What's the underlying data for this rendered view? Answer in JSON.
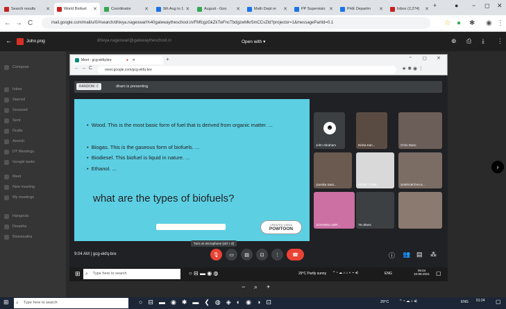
{
  "outer_tabs": [
    {
      "label": "Search results",
      "color": "#c5221f"
    },
    {
      "label": "World Biofuel",
      "color": "#c5221f"
    },
    {
      "label": "Coordinator",
      "color": "#34a853"
    },
    {
      "label": "9th Aug to 1",
      "color": "#1a73e8"
    },
    {
      "label": "August - Goo",
      "color": "#34a853"
    },
    {
      "label": "Math Dept re",
      "color": "#1a73e8"
    },
    {
      "label": "PP Supervisio",
      "color": "#1a73e8"
    },
    {
      "label": "PHE Departm",
      "color": "#1a73e8"
    },
    {
      "label": "Inbox (2,274)",
      "color": "#c5221f"
    }
  ],
  "outer_url": "mail.google.com/mail/u/0/#search/dhivya.nageswari%40gatewaytheschool.in/FMfcgzGkZkTwFncTbdgzwMkr5mCCvZld?projector=1&messagePartId=0.1",
  "preview": {
    "filename": "John.png",
    "search_text": "dhivya.nageswari@gatewaytheschool.in",
    "open_with": "Open with"
  },
  "gmail_sidebar": [
    "Compose",
    "Inbox",
    "Starred",
    "Snoozed",
    "Sent",
    "Drafts",
    "Amrish",
    "DT Meetings",
    "Google tasks",
    "Meet",
    "New meeting",
    "My meetings",
    "Hangouts",
    "Deepika",
    "Biswanatha"
  ],
  "meet": {
    "tab_title": "Meet - gcg-ekfq-bre",
    "url": "meet.google.com/gcg-ekfq-bre",
    "presenting_label": "RANDOM",
    "presenting_text": "dham is presenting",
    "time_code": "9:04 AM  |  gcg-ekfq-bre",
    "tooltip": "Turn on microphone (ctrl + d)"
  },
  "slide": {
    "bullets": [
      "Wood. This is the most basic form of fuel that is derived from organic matter. ...",
      "Biogas. This is the gaseous form of biofuels. ...",
      "Biodiesel. This biofuel is liquid in nature. ...",
      "Ethanol. ..."
    ],
    "question": "what are the types of biofuels?",
    "logo_top": "CREATED USING",
    "logo": "POWTOON"
  },
  "participants": [
    {
      "name": "John Abraham"
    },
    {
      "name": "Nisha Kan..."
    },
    {
      "name": "Chris Dario"
    },
    {
      "name": "Janvika Sant..."
    },
    {
      "name": "Rithvik Thilak..."
    },
    {
      "name": "SAMYUKTHA K..."
    },
    {
      "name": "JOHANNA ABR..."
    },
    {
      "name": "79 others"
    },
    {
      "name": ""
    }
  ],
  "taskbar_inner": {
    "search": "Type here to search",
    "weather": "29°C  Partly sunny",
    "lang": "ENG",
    "time": "09:04",
    "date": "10-08-2021"
  },
  "taskbar_outer": {
    "search": "Type here to search",
    "weather": "29°C",
    "lang": "ENG",
    "time": "01:24"
  }
}
